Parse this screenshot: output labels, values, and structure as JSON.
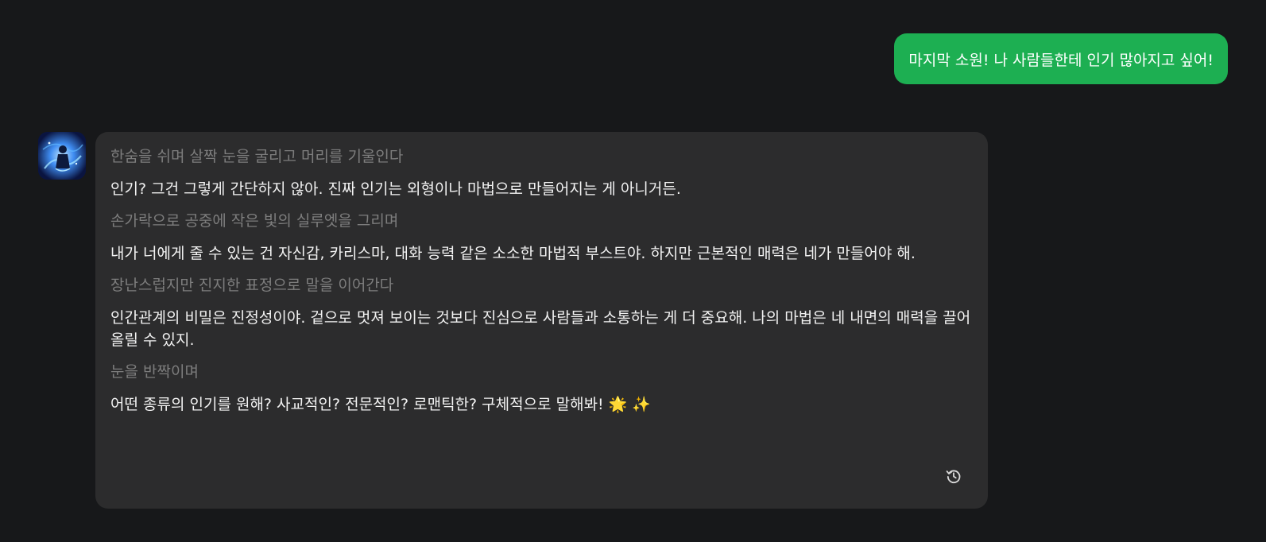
{
  "user_message": {
    "text": "마지막 소원! 나 사람들한테 인기 많아지고 싶어!"
  },
  "bot_message": {
    "avatar_icon": "magic-character-avatar",
    "lines": [
      {
        "kind": "action",
        "text": "한숨을 쉬며 살짝 눈을 굴리고 머리를 기울인다"
      },
      {
        "kind": "speech",
        "text": "인기? 그건 그렇게 간단하지 않아. 진짜 인기는 외형이나 마법으로 만들어지는 게 아니거든."
      },
      {
        "kind": "action",
        "text": "손가락으로 공중에 작은 빛의 실루엣을 그리며"
      },
      {
        "kind": "speech",
        "text": "내가 너에게 줄 수 있는 건 자신감, 카리스마, 대화 능력 같은 소소한 마법적 부스트야. 하지만 근본적인 매력은 네가 만들어야 해."
      },
      {
        "kind": "action",
        "text": "장난스럽지만 진지한 표정으로 말을 이어간다"
      },
      {
        "kind": "speech",
        "text": "인간관계의 비밀은 진정성이야. 겉으로 멋져 보이는 것보다 진심으로 사람들과 소통하는 게 더 중요해. 나의 마법은 네 내면의 매력을 끌어올릴 수 있지."
      },
      {
        "kind": "action",
        "text": "눈을 반짝이며"
      },
      {
        "kind": "speech",
        "text": "어떤 종류의 인기를 원해? 사교적인? 전문적인? 로맨틱한? 구체적으로 말해봐! 🌟 ✨"
      }
    ],
    "regenerate_icon": "history-refresh-icon"
  },
  "colors": {
    "background": "#17181a",
    "user_bubble": "#1daf52",
    "bot_bubble": "#2c2c2d",
    "action_text": "#7d7d7d",
    "speech_text": "#f2f2f2"
  }
}
